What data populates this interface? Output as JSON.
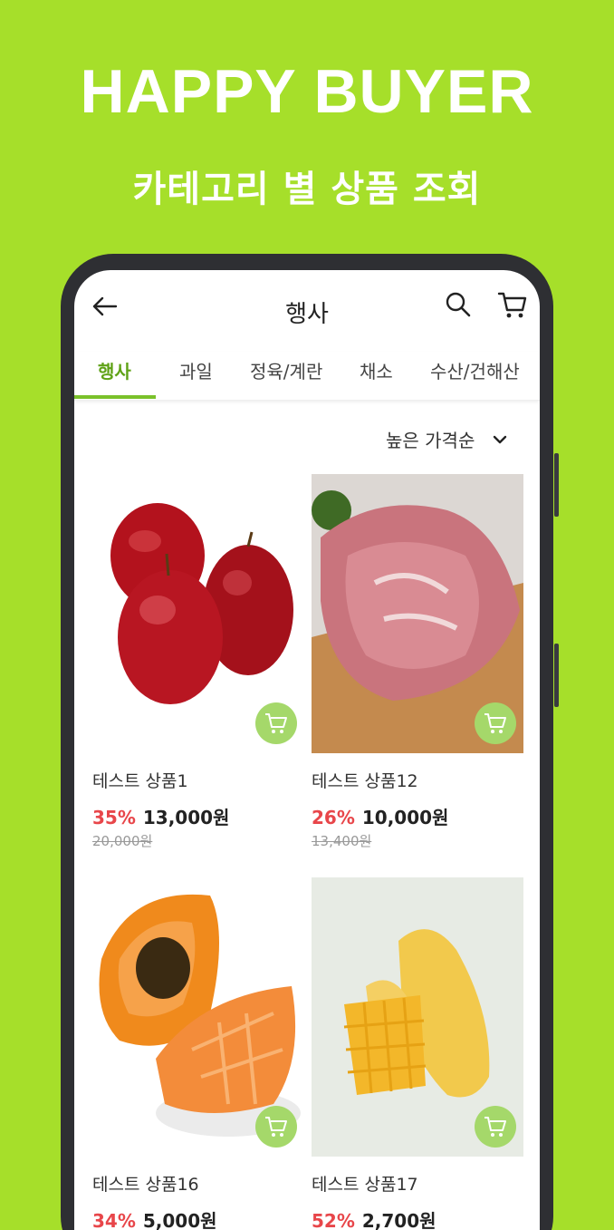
{
  "promo": {
    "title": "HAPPY BUYER",
    "subtitle": "카테고리 별 상품 조회"
  },
  "header": {
    "title": "행사",
    "icons": [
      "back-arrow-icon",
      "search-icon",
      "cart-icon"
    ]
  },
  "tabs": [
    {
      "label": "행사",
      "active": true
    },
    {
      "label": "과일",
      "active": false
    },
    {
      "label": "정육/계란",
      "active": false
    },
    {
      "label": "채소",
      "active": false
    },
    {
      "label": "수산/건해산",
      "active": false
    }
  ],
  "sort": {
    "label": "높은 가격순"
  },
  "products": [
    {
      "name": "테스트 상품1",
      "discount": "35%",
      "price": "13,000원",
      "original": "20,000원",
      "image": "apples"
    },
    {
      "name": "테스트 상품12",
      "discount": "26%",
      "price": "10,000원",
      "original": "13,400원",
      "image": "pork"
    },
    {
      "name": "테스트 상품16",
      "discount": "34%",
      "price": "5,000원",
      "original": "",
      "image": "papaya"
    },
    {
      "name": "테스트 상품17",
      "discount": "52%",
      "price": "2,700원",
      "original": "",
      "image": "mango"
    }
  ],
  "colors": {
    "background": "#a6df2a",
    "accent": "#7ac12a",
    "discount": "#e8464a",
    "cart_button": "#a5d86a"
  }
}
